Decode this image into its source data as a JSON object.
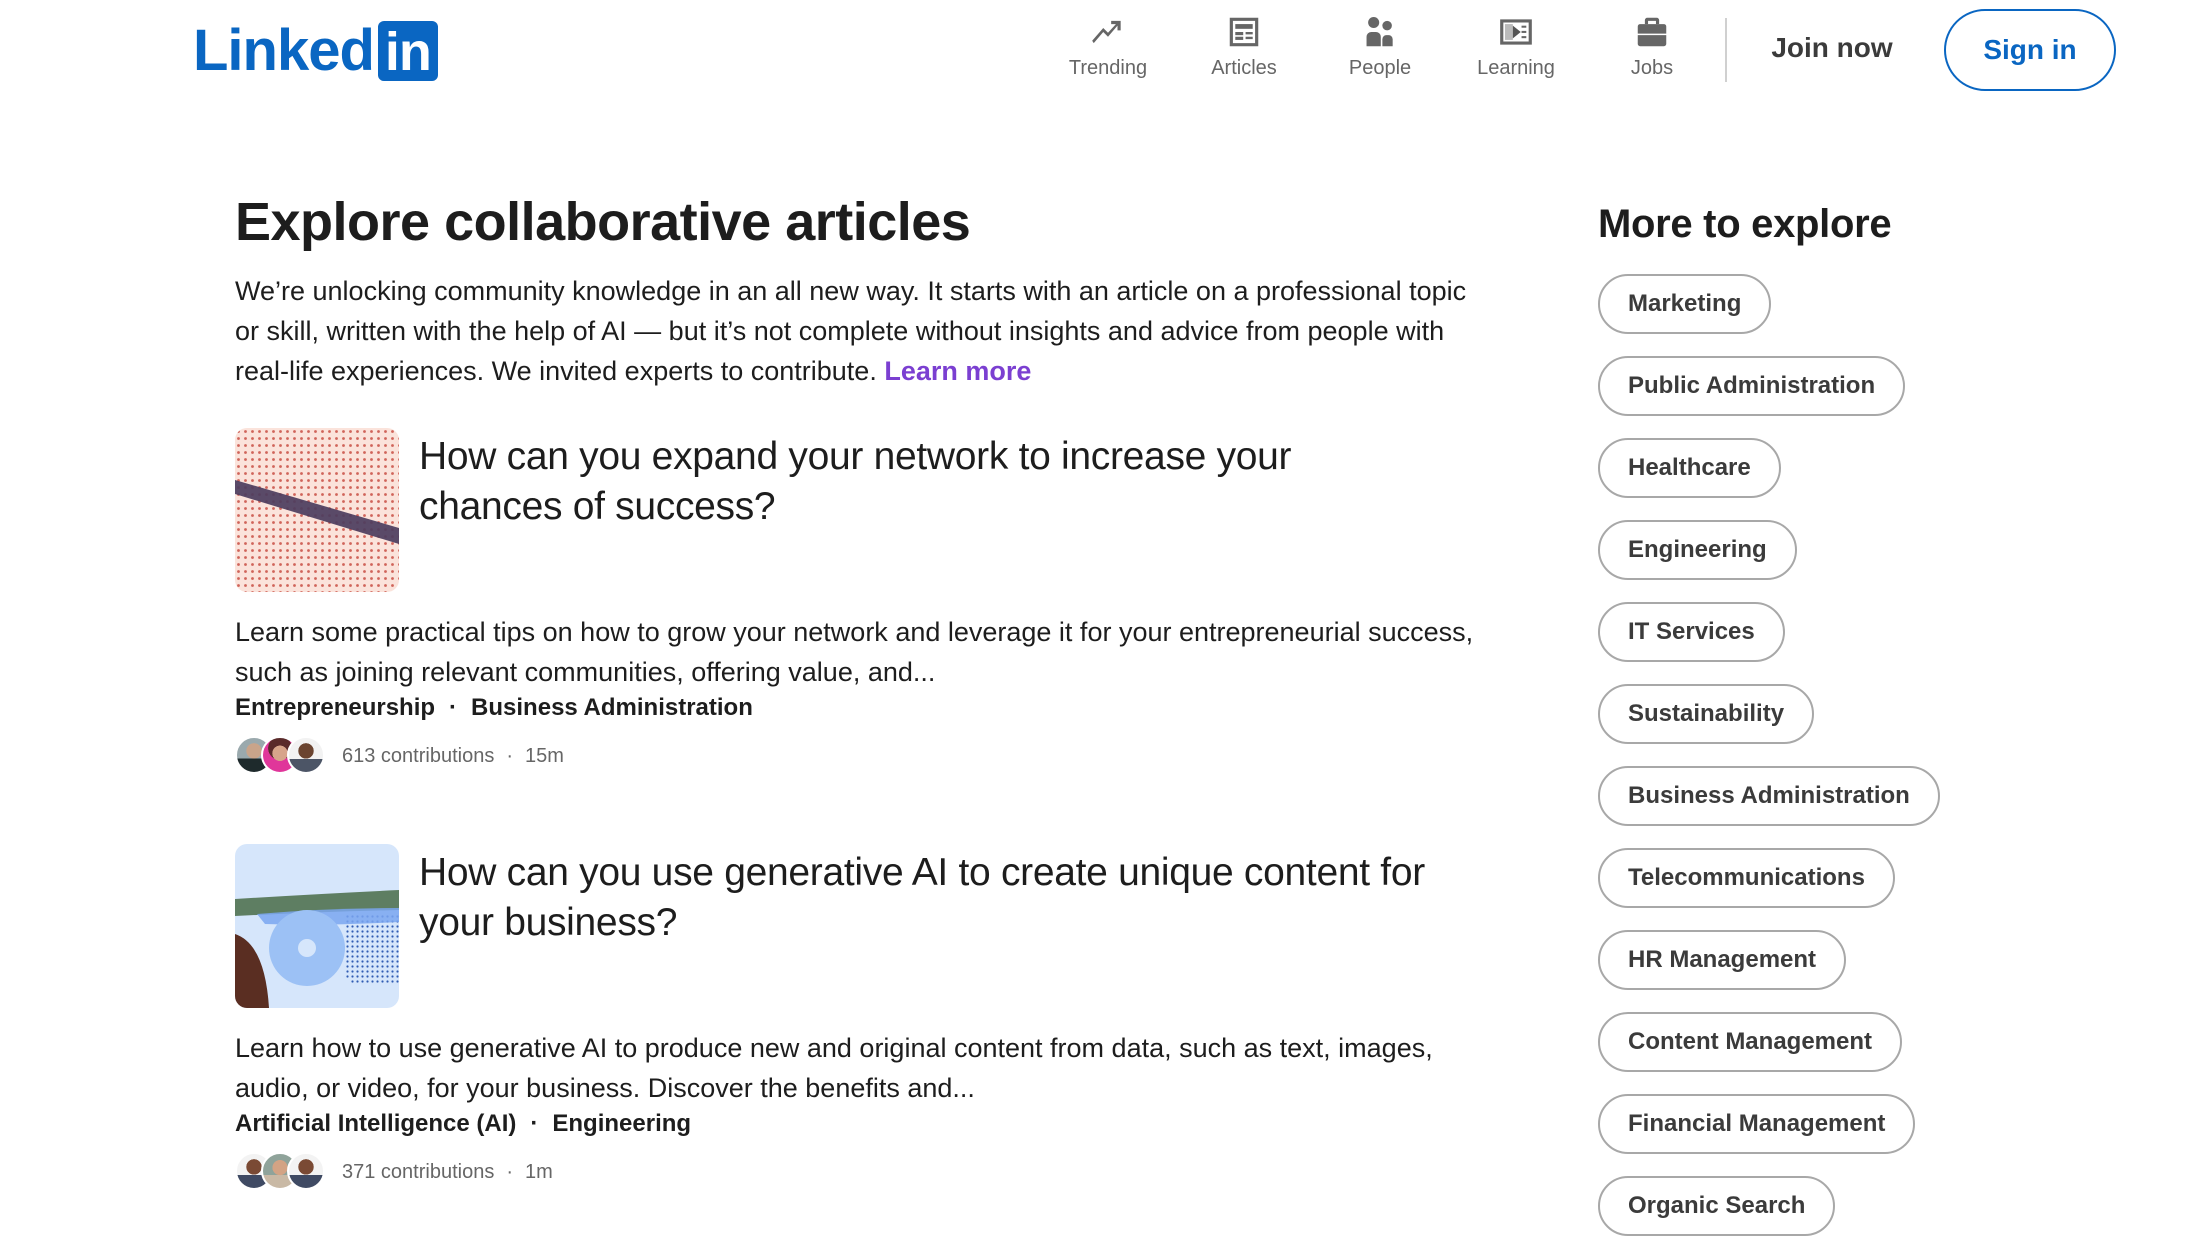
{
  "header": {
    "logo_text": "Linked",
    "logo_box_text": "in",
    "brand_color": "#0a66c2",
    "nav": [
      {
        "label": "Trending",
        "icon": "trending-icon"
      },
      {
        "label": "Articles",
        "icon": "articles-icon"
      },
      {
        "label": "People",
        "icon": "people-icon"
      },
      {
        "label": "Learning",
        "icon": "learning-icon"
      },
      {
        "label": "Jobs",
        "icon": "jobs-icon"
      }
    ],
    "join_label": "Join now",
    "signin_label": "Sign in"
  },
  "main": {
    "title": "Explore collaborative articles",
    "intro": "We’re unlocking community knowledge in an all new way. It starts with an article on a professional topic or skill, written with the help of AI — but it’s not complete without insights and advice from people with real-life experiences. We invited experts to contribute.",
    "learn_more": "Learn more",
    "link_color": "#7b3fd1",
    "articles": [
      {
        "title": "How can you expand your network to increase your chances of success?",
        "description": "Learn some practical tips on how to grow your network and leverage it for your entrepreneurial success, such as joining relevant communities, offering value, and...",
        "tags": [
          "Entrepreneurship",
          "Business Administration"
        ],
        "tag_separator": "·",
        "contributions": "613 contributions",
        "meta_separator": "·",
        "time": "15m"
      },
      {
        "title": "How can you use generative AI to create unique content for your business?",
        "description": "Learn how to use generative AI to produce new and original content from data, such as text, images, audio, or video, for your business. Discover the benefits and...",
        "tags": [
          "Artificial Intelligence (AI)",
          "Engineering"
        ],
        "tag_separator": "·",
        "contributions": "371 contributions",
        "meta_separator": "·",
        "time": "1m"
      }
    ]
  },
  "sidebar": {
    "title": "More to explore",
    "topics": [
      "Marketing",
      "Public Administration",
      "Healthcare",
      "Engineering",
      "IT Services",
      "Sustainability",
      "Business Administration",
      "Telecommunications",
      "HR Management",
      "Content Management",
      "Financial Management",
      "Organic Search"
    ]
  }
}
